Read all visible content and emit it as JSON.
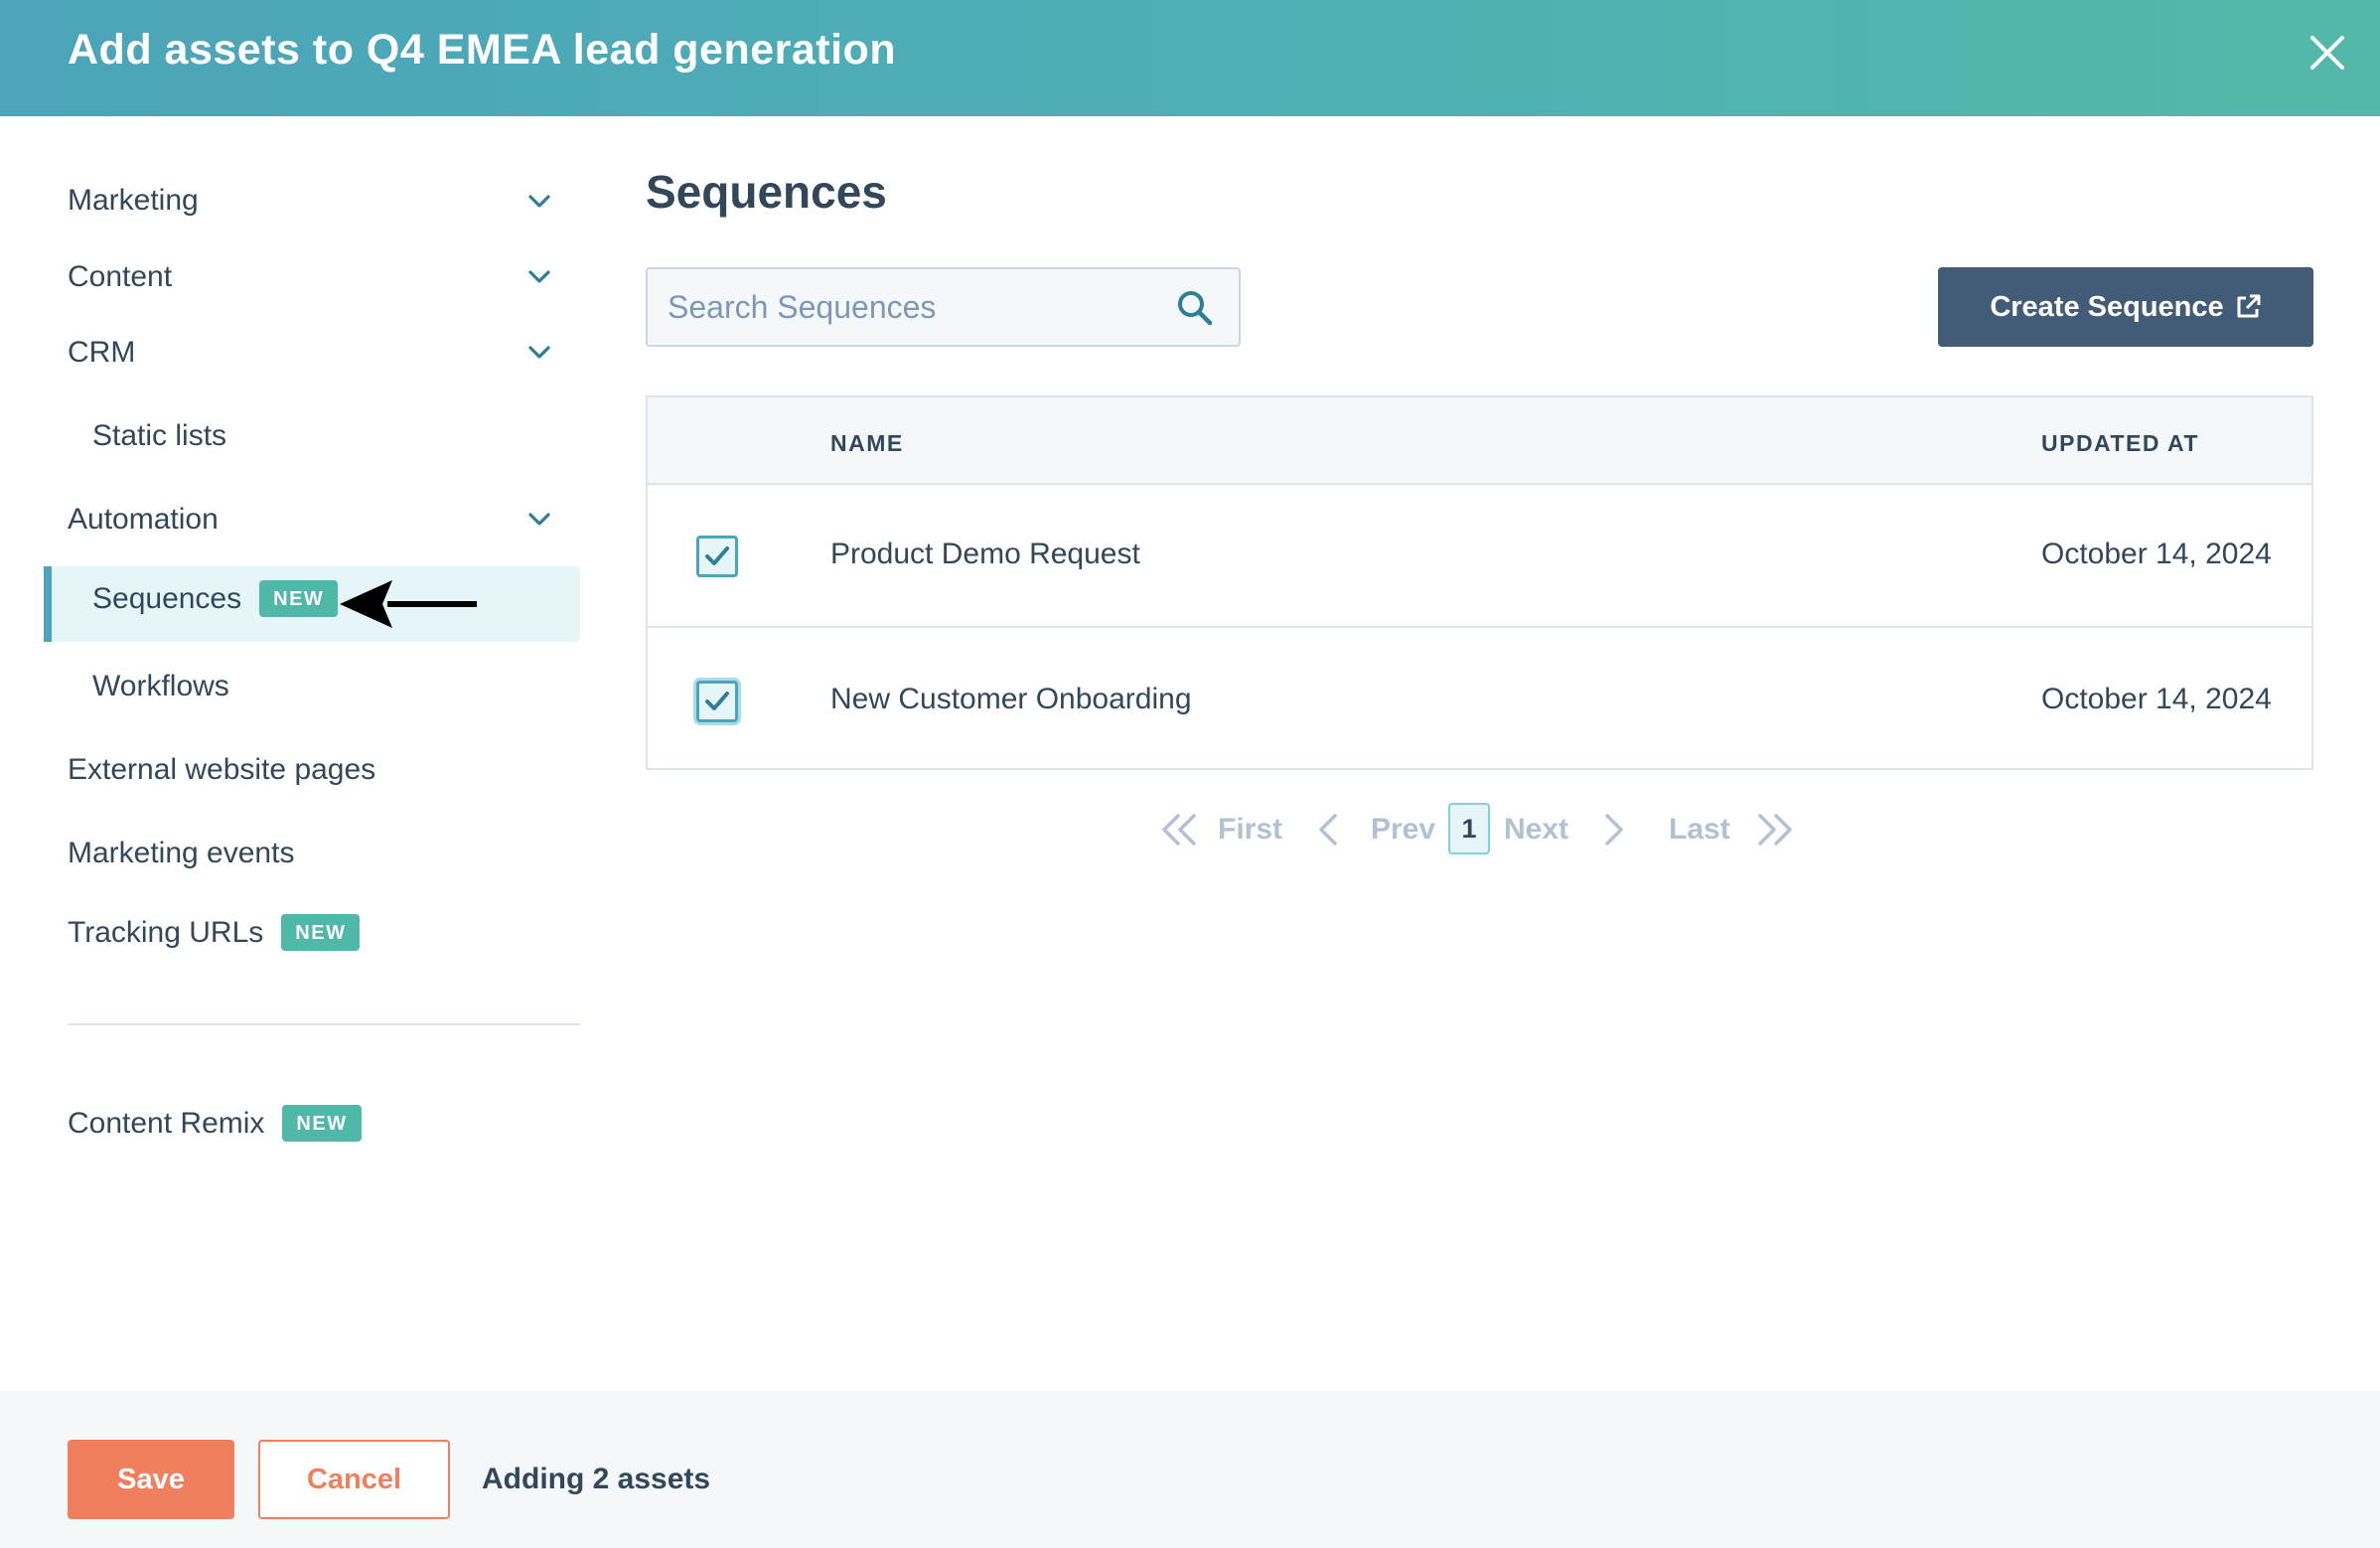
{
  "modal": {
    "title": "Add assets to Q4 EMEA lead generation",
    "close_icon": "close-icon"
  },
  "sidebar": {
    "items": [
      {
        "label": "Marketing",
        "expandable": true
      },
      {
        "label": "Content",
        "expandable": true
      },
      {
        "label": "CRM",
        "expandable": true
      },
      {
        "label": "Static lists",
        "sub": true
      },
      {
        "label": "Automation",
        "expandable": true
      },
      {
        "label": "Sequences",
        "sub": true,
        "active": true,
        "badge": "NEW"
      },
      {
        "label": "Workflows",
        "sub": true
      },
      {
        "label": "External website pages"
      },
      {
        "label": "Marketing events"
      },
      {
        "label": "Tracking URLs",
        "badge": "NEW"
      },
      {
        "label": "Content Remix",
        "badge": "NEW"
      }
    ]
  },
  "main": {
    "title": "Sequences",
    "search": {
      "placeholder": "Search Sequences",
      "value": ""
    },
    "create_button": "Create Sequence",
    "table": {
      "columns": [
        "NAME",
        "UPDATED AT"
      ],
      "rows": [
        {
          "name": "Product Demo Request",
          "updated_at": "October 14, 2024",
          "checked": true
        },
        {
          "name": "New Customer Onboarding",
          "updated_at": "October 14, 2024",
          "checked": true
        }
      ]
    },
    "pagination": {
      "first": "First",
      "prev": "Prev",
      "current_page": "1",
      "next": "Next",
      "last": "Last"
    }
  },
  "footer": {
    "save": "Save",
    "cancel": "Cancel",
    "status": "Adding 2 assets"
  },
  "colors": {
    "header_start": "#4ba4b9",
    "header_end": "#52b9a9",
    "primary_text": "#33475b",
    "badge": "#4fb8a8",
    "save": "#f07f5e",
    "create_button": "#425b76",
    "active_bg": "#e5f5f8"
  }
}
